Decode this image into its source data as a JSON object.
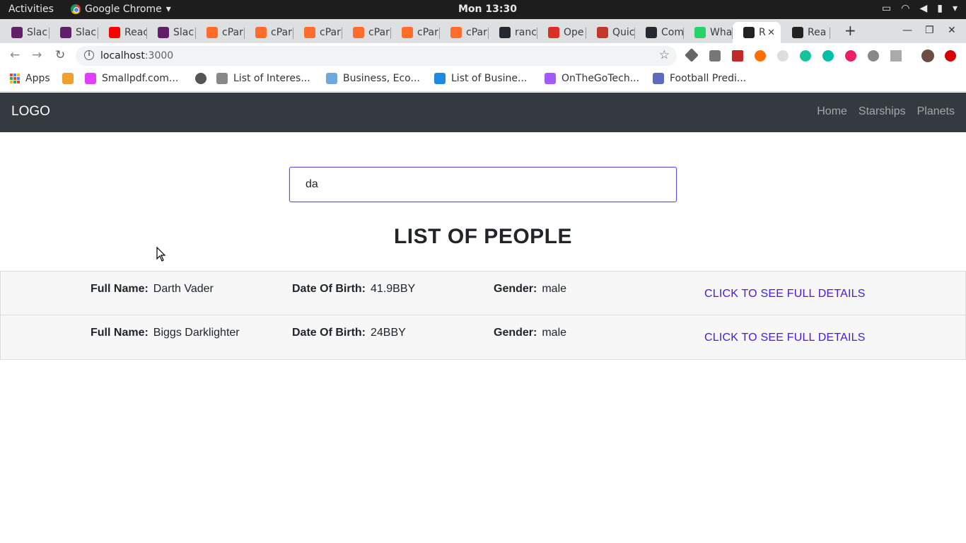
{
  "os": {
    "activities": "Activities",
    "app_name": "Google Chrome",
    "clock": "Mon 13:30"
  },
  "browser": {
    "tabs": [
      {
        "label": "Slac",
        "color": "#611f69"
      },
      {
        "label": "Slac",
        "color": "#611f69"
      },
      {
        "label": "Reac",
        "color": "#ff0000"
      },
      {
        "label": "Slac",
        "color": "#611f69"
      },
      {
        "label": "cPar",
        "color": "#ff6c2c"
      },
      {
        "label": "cPar",
        "color": "#ff6c2c"
      },
      {
        "label": "cPar",
        "color": "#ff6c2c"
      },
      {
        "label": "cPar",
        "color": "#ff6c2c"
      },
      {
        "label": "cPar",
        "color": "#ff6c2c"
      },
      {
        "label": "cPar",
        "color": "#ff6c2c"
      },
      {
        "label": "ranc",
        "color": "#24292e"
      },
      {
        "label": "Ope",
        "color": "#d93025"
      },
      {
        "label": "Quic",
        "color": "#c0392b"
      },
      {
        "label": "Com",
        "color": "#24292e"
      },
      {
        "label": "Wha",
        "color": "#25d366"
      },
      {
        "label": "R",
        "color": "#222",
        "active": true
      },
      {
        "label": "Rea",
        "color": "#222"
      }
    ],
    "url_host": "localhost",
    "url_port": ":3000"
  },
  "bookmarks": [
    {
      "label": "Apps",
      "color": "#4285f4"
    },
    {
      "label": "",
      "color": "#f0a030"
    },
    {
      "label": "Smallpdf.com...",
      "color": "#e040fb"
    },
    {
      "label": "",
      "color": "#555"
    },
    {
      "label": "List of Interes...",
      "color": "#888"
    },
    {
      "label": "Business, Eco...",
      "color": "#6fa8dc"
    },
    {
      "label": "List of Busine...",
      "color": "#1e88e5"
    },
    {
      "label": "OnTheGoTech...",
      "color": "#a259ff"
    },
    {
      "label": "Football Predi...",
      "color": "#5c6bc0"
    }
  ],
  "nav": {
    "logo": "LOGO",
    "links": [
      "Home",
      "Starships",
      "Planets"
    ]
  },
  "search": {
    "value": "da"
  },
  "heading": "LIST OF PEOPLE",
  "labels": {
    "name": "Full Name:",
    "dob": "Date Of Birth:",
    "gender": "Gender:",
    "details": "CLICK TO SEE FULL DETAILS"
  },
  "people": [
    {
      "name": "Darth Vader",
      "dob": "41.9BBY",
      "gender": "male"
    },
    {
      "name": "Biggs Darklighter",
      "dob": "24BBY",
      "gender": "male"
    }
  ]
}
